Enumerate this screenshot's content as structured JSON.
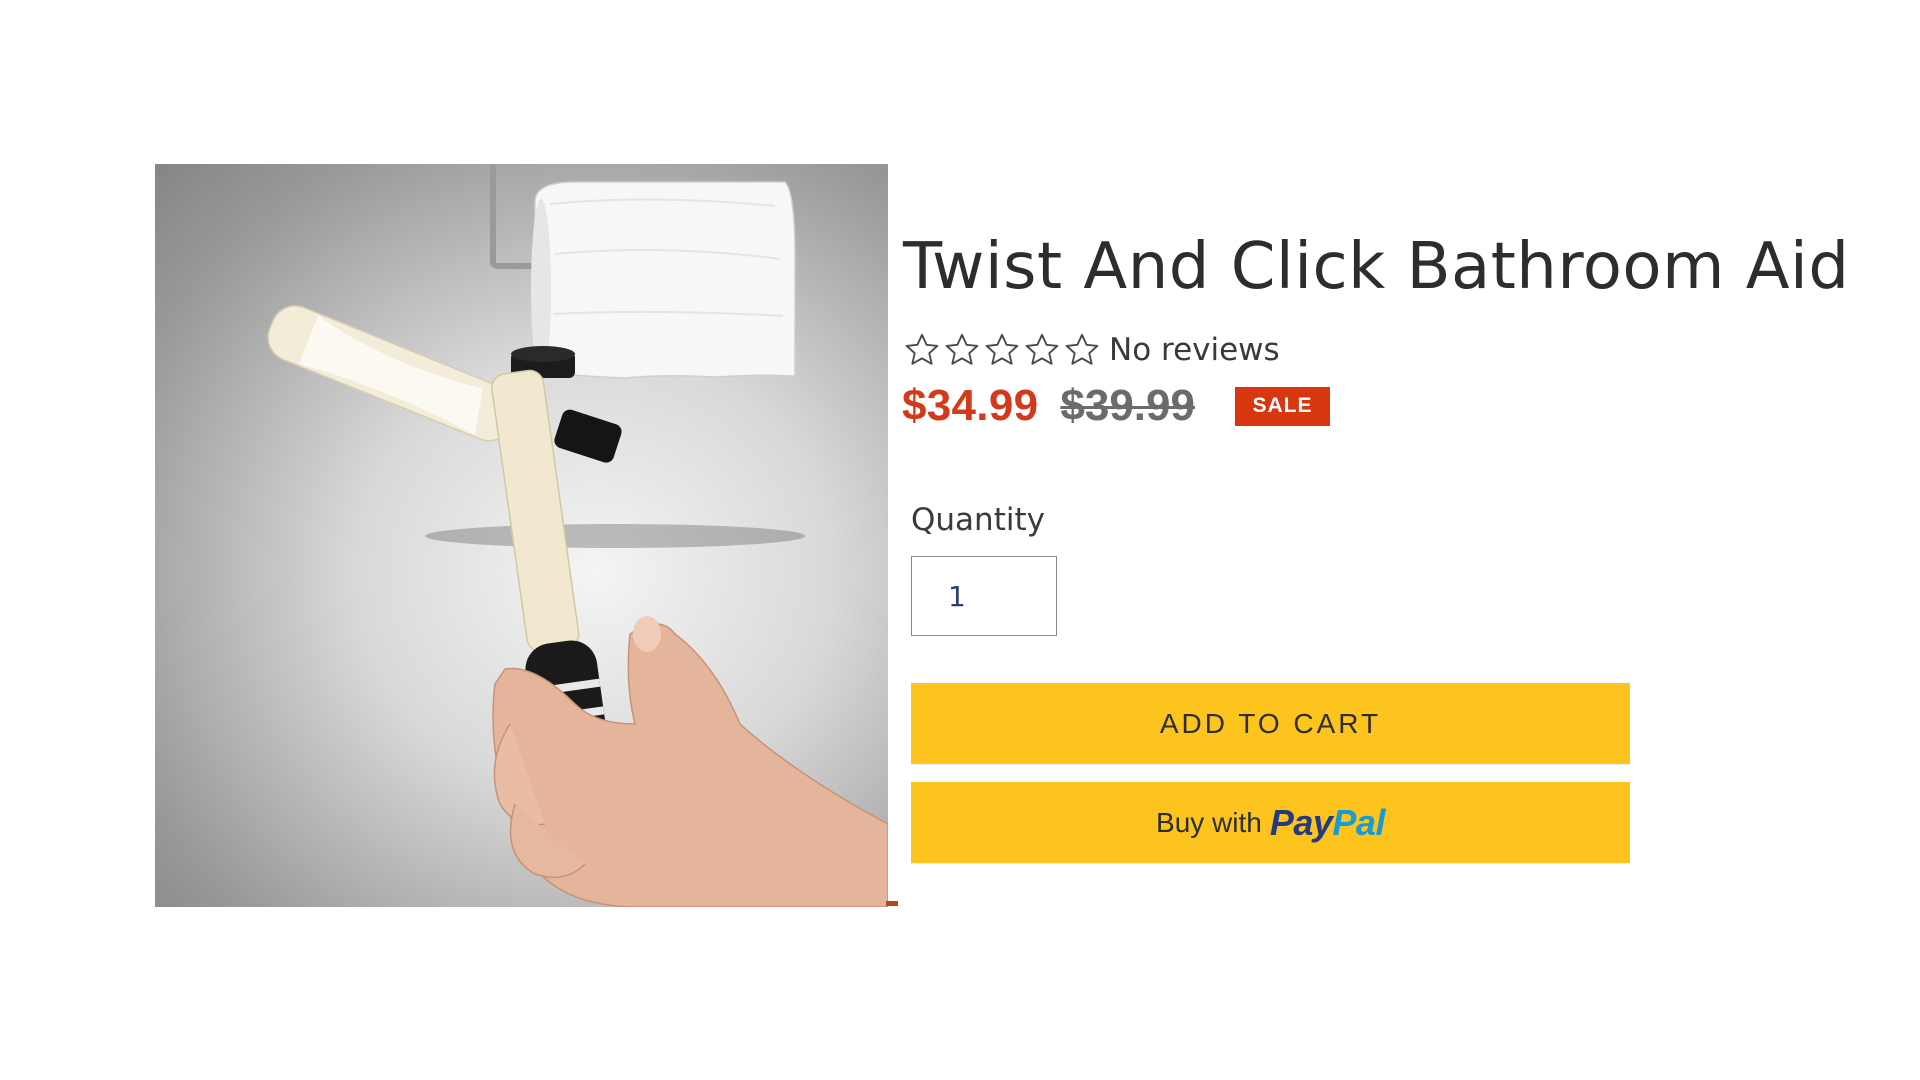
{
  "product": {
    "title": "Twist And Click Bathroom Aid",
    "rating": {
      "stars_filled": 0,
      "stars_total": 5,
      "reviews_label": "No reviews"
    },
    "price": {
      "sale": "$34.99",
      "regular": "$39.99",
      "badge": "SALE"
    },
    "image_alt": "Twist And Click Bathroom Aid"
  },
  "quantity": {
    "label": "Quantity",
    "value": "1"
  },
  "buttons": {
    "add_to_cart": "ADD TO CART",
    "paypal_prefix": "Buy with",
    "paypal_pay": "Pay",
    "paypal_pal": "Pal"
  },
  "colors": {
    "sale_price": "#d33a1c",
    "badge": "#d8360e",
    "button": "#fcc41c",
    "paypal_dark": "#253b80",
    "paypal_light": "#179bd7"
  }
}
